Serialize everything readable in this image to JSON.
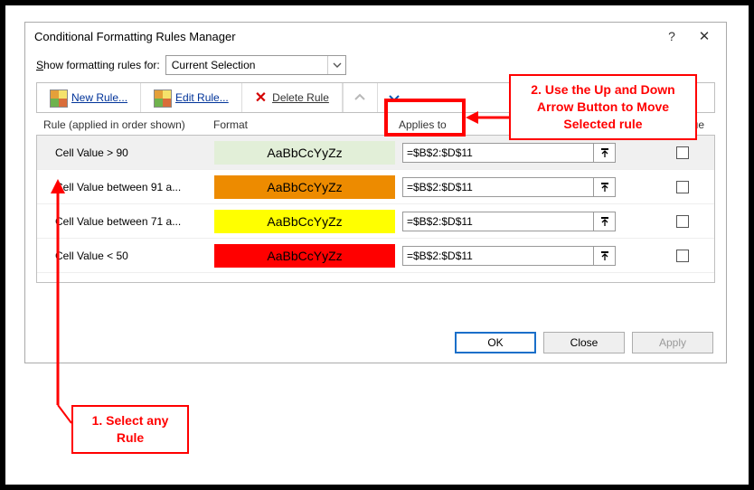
{
  "dialog": {
    "title": "Conditional Formatting Rules Manager",
    "help_symbol": "?",
    "close_symbol": "✕",
    "show_label_pre": "S",
    "show_label_rest": "how formatting rules for:",
    "show_value": "Current Selection",
    "toolbar": {
      "new_pre": "N",
      "new_rest": "ew Rule...",
      "edit_pre": "E",
      "edit_rest": "dit Rule...",
      "delete_pre": "D",
      "delete_rest": "elete Rule"
    },
    "headers": {
      "rule": "Rule (applied in order shown)",
      "format": "Format",
      "applies": "Applies to",
      "stop": "Stop If True"
    },
    "format_sample": "AaBbCcYyZz",
    "rules": [
      {
        "text": "Cell Value > 90",
        "applies": "=$B$2:$D$11",
        "fmt": "fmt0",
        "selected": true
      },
      {
        "text": "Cell Value between 91 a...",
        "applies": "=$B$2:$D$11",
        "fmt": "fmt1",
        "selected": false
      },
      {
        "text": "Cell Value between 71 a...",
        "applies": "=$B$2:$D$11",
        "fmt": "fmt2",
        "selected": false
      },
      {
        "text": "Cell Value < 50",
        "applies": "=$B$2:$D$11",
        "fmt": "fmt3",
        "selected": false
      }
    ],
    "footer": {
      "ok": "OK",
      "close": "Close",
      "apply": "Apply"
    }
  },
  "annotations": {
    "callout_top_l1": "2. Use the Up and Down",
    "callout_top_l2": "Arrow Button to Move",
    "callout_top_l3": "Selected rule",
    "callout_bottom_l1": "1. Select any",
    "callout_bottom_l2": "Rule"
  }
}
